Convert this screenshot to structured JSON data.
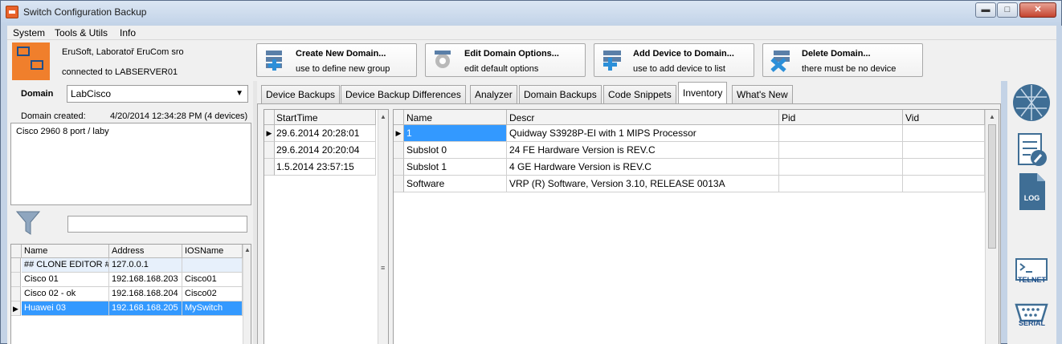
{
  "window": {
    "title": "Switch Configuration Backup",
    "minimize": "▬",
    "maximize": "□",
    "close": "✕"
  },
  "menu": [
    "System",
    "Tools & Utils",
    "Info"
  ],
  "header": {
    "company": "EruSoft, Laboratoř EruCom sro",
    "connection": "connected to LABSERVER01"
  },
  "toolbar": {
    "buttons": [
      {
        "title": "Create New Domain...",
        "subtitle": "use to define new group",
        "icon": "server-add-icon"
      },
      {
        "title": "Edit Domain Options...",
        "subtitle": "edit default options",
        "icon": "gear-edit-icon"
      },
      {
        "title": "Add Device to Domain...",
        "subtitle": "use to add device to list",
        "icon": "device-add-icon"
      },
      {
        "title": "Delete Domain...",
        "subtitle": "there must be no device",
        "icon": "delete-domain-icon"
      }
    ]
  },
  "left": {
    "domain_label": "Domain",
    "domain_value": "LabCisco",
    "created_label": "Domain created:",
    "created_value": "4/20/2014 12:34:28 PM (4 devices)",
    "description": "Cisco 2960 8 port / laby",
    "filter_value": "",
    "device_columns": [
      "Name",
      "Address",
      "IOSName"
    ],
    "devices": [
      {
        "name": "## CLONE EDITOR ##",
        "address": "127.0.0.1",
        "ios": ""
      },
      {
        "name": "Cisco 01",
        "address": "192.168.168.203",
        "ios": "Cisco01"
      },
      {
        "name": "Cisco 02 - ok",
        "address": "192.168.168.204",
        "ios": "Cisco02"
      },
      {
        "name": "Huawei 03",
        "address": "192.168.168.205",
        "ios": "MySwitch"
      }
    ]
  },
  "tabs": [
    "Device Backups",
    "Device Backup Differences",
    "Analyzer",
    "Domain Backups",
    "Code Snippets",
    "Inventory",
    "What's New"
  ],
  "active_tab": "Inventory",
  "backups": {
    "column": "StartTime",
    "rows": [
      "29.6.2014 20:28:01",
      "29.6.2014 20:20:04",
      "1.5.2014 23:57:15"
    ]
  },
  "inventory": {
    "columns": [
      "Name",
      "Descr",
      "Pid",
      "Vid"
    ],
    "rows": [
      {
        "name": "1",
        "descr": "Quidway S3928P-EI with 1 MIPS Processor",
        "pid": "",
        "vid": ""
      },
      {
        "name": "Subslot 0",
        "descr": "24 FE Hardware Version is REV.C",
        "pid": "",
        "vid": ""
      },
      {
        "name": "Subslot 1",
        "descr": "4 GE  Hardware Version is REV.C",
        "pid": "",
        "vid": ""
      },
      {
        "name": "Software",
        "descr": "VRP (R) Software, Version 3.10, RELEASE 0013A",
        "pid": "",
        "vid": ""
      }
    ]
  },
  "right_bar": [
    {
      "icon": "network-globe-icon",
      "caption": ""
    },
    {
      "icon": "document-edit-icon",
      "caption": ""
    },
    {
      "icon": "log-file-icon",
      "caption": "LOG"
    },
    {
      "icon": "telnet-terminal-icon",
      "caption": "TELNET"
    },
    {
      "icon": "serial-port-icon",
      "caption": "SERIAL"
    }
  ],
  "colors": {
    "selection": "#3399ff",
    "accent": "#1e4f8a",
    "logo": "#f07f2c"
  }
}
